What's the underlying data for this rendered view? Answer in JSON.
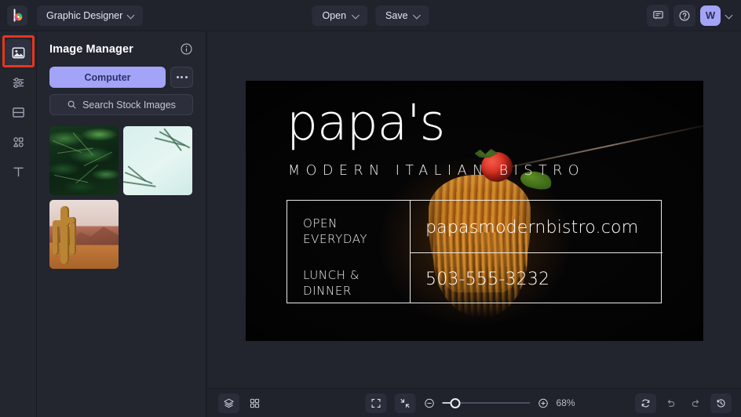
{
  "topbar": {
    "logo_icon": "befunky-logo-icon",
    "mode_label": "Graphic Designer",
    "mode_chevron_icon": "chevron-down-icon",
    "open_label": "Open",
    "save_label": "Save",
    "feedback_icon": "chat-bubble-icon",
    "help_icon": "question-circle-icon",
    "avatar_initial": "W",
    "avatar_chevron_icon": "chevron-down-icon",
    "avatar_color": "#a3a4f7"
  },
  "rail": {
    "items": [
      {
        "name": "image-manager",
        "icon": "image-icon",
        "active": true
      },
      {
        "name": "edit-adjust",
        "icon": "sliders-icon",
        "active": false
      },
      {
        "name": "templates",
        "icon": "layout-icon",
        "active": false
      },
      {
        "name": "graphics",
        "icon": "shapes-icon",
        "active": false
      },
      {
        "name": "text",
        "icon": "text-icon",
        "active": false
      }
    ],
    "highlight_color": "#e8361b"
  },
  "panel": {
    "title": "Image Manager",
    "info_icon": "info-circle-icon",
    "computer_label": "Computer",
    "more_icon": "ellipsis-icon",
    "search_icon": "search-icon",
    "search_placeholder": "Search Stock Images",
    "thumbnails": [
      {
        "name": "thumbnail-tropical-leaves",
        "alt": "tropical green leaves"
      },
      {
        "name": "thumbnail-mint-palm",
        "alt": "mint background with palm fronds"
      },
      {
        "name": "thumbnail-desert-cactus",
        "alt": "desert cactus and mountain"
      }
    ]
  },
  "artboard": {
    "headline": "papa's",
    "subhead": "MODERN ITALIAN BISTRO",
    "info": {
      "hours_line1": "OPEN",
      "hours_line2": "EVERYDAY",
      "meals_line1": "LUNCH &",
      "meals_line2": "DINNER",
      "website": "papasmodernbistro.com",
      "phone": "503-555-3232"
    },
    "background_alt": "pasta twirled on fork with cherry tomato and basil"
  },
  "bottombar": {
    "layers_icon": "layers-icon",
    "grid_icon": "grid-icon",
    "fit_icon": "fit-to-screen-icon",
    "shrink_icon": "collapse-arrows-icon",
    "zoom_out_icon": "minus-circle-icon",
    "zoom_in_icon": "plus-circle-icon",
    "zoom_level": "68%",
    "reset_icon": "refresh-icon",
    "undo_icon": "undo-icon",
    "redo_icon": "redo-icon",
    "history_icon": "history-icon"
  }
}
